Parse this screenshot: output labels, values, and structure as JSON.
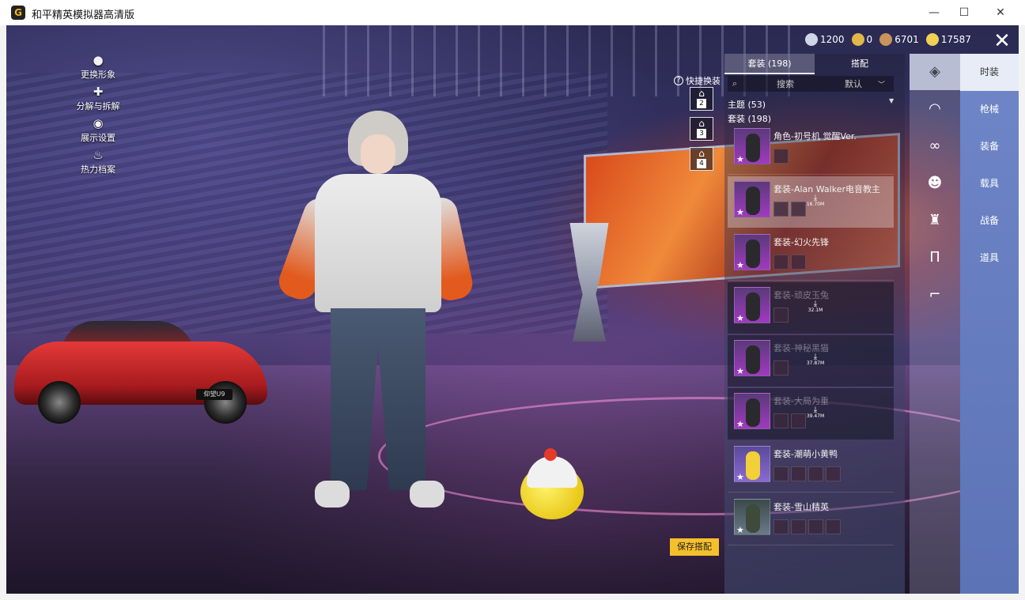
{
  "window": {
    "title": "和平精英模拟器高清版",
    "app_icon_glyph": "G",
    "min_glyph": "—",
    "max_glyph": "☐",
    "close_glyph": "✕"
  },
  "left_menu": [
    {
      "label": "更换形象",
      "icon": "person-icon",
      "glyph": "●"
    },
    {
      "label": "分解与拆解",
      "icon": "puzzle-icon",
      "glyph": "✚"
    },
    {
      "label": "展示设置",
      "icon": "eye-icon",
      "glyph": "◉"
    },
    {
      "label": "热力档案",
      "icon": "flame-icon",
      "glyph": "♨"
    }
  ],
  "currency": [
    {
      "value": "1200",
      "icon": "silver-coin-icon",
      "color": "#cfd6e6"
    },
    {
      "value": "0",
      "icon": "gold-badge-icon",
      "color": "#e0b84a"
    },
    {
      "value": "6701",
      "icon": "bronze-coin-icon",
      "color": "#c8945a"
    },
    {
      "value": "17587",
      "icon": "gold-coin-icon",
      "color": "#f2d056"
    }
  ],
  "close_glyph": "✕",
  "car_plate": "仰望U9",
  "quick_swap": {
    "label": "快捷换装",
    "help_glyph": "?",
    "slots": [
      "2",
      "3",
      "4"
    ],
    "slot_glyph": "⌂"
  },
  "save_button": "保存搭配",
  "panel": {
    "tabs": [
      {
        "label": "套装 (198)",
        "active": true
      },
      {
        "label": "搭配",
        "active": false
      }
    ],
    "search_glyph": "⌕",
    "search_placeholder": "搜索",
    "sort_label": "默认",
    "sort_caret": "﹀",
    "category_caret": "▼",
    "categories": [
      "主题 (53)",
      "套装 (198)"
    ],
    "items": [
      {
        "name": "角色-初号机 觉醒Ver.",
        "parts": 1,
        "download": "",
        "state": "plain"
      },
      {
        "name": "套装-Alan Walker电音教主",
        "parts": 2,
        "download": "16.70M",
        "state": "selected"
      },
      {
        "name": "套装-幻火先锋",
        "parts": 2,
        "download": "",
        "state": "plain"
      },
      {
        "name": "套装-顽皮玉兔",
        "parts": 1,
        "download": "32.1M",
        "state": "dim"
      },
      {
        "name": "套装-神秘黑猫",
        "parts": 1,
        "download": "37.87M",
        "state": "dim"
      },
      {
        "name": "套装-大局为重",
        "parts": 2,
        "download": "39.47M",
        "state": "dim"
      },
      {
        "name": "套装-潮萌小黄鸭",
        "parts": 4,
        "download": "",
        "state": "plain"
      },
      {
        "name": "套装-雪山精英",
        "parts": 4,
        "download": "",
        "state": "plain"
      }
    ],
    "star_glyph": "★",
    "download_glyph": "⤓"
  },
  "rail_icons": [
    {
      "icon": "outfit-icon",
      "glyph": "◈",
      "active": true
    },
    {
      "icon": "cap-icon",
      "glyph": "◠",
      "active": false
    },
    {
      "icon": "goggles-icon",
      "glyph": "∞",
      "active": false
    },
    {
      "icon": "mask-icon",
      "glyph": "☻",
      "active": false
    },
    {
      "icon": "jacket-icon",
      "glyph": "♜",
      "active": false
    },
    {
      "icon": "pants-icon",
      "glyph": "Π",
      "active": false
    },
    {
      "icon": "shoes-icon",
      "glyph": "⌐",
      "active": false
    }
  ],
  "categories_right": [
    {
      "label": "时装",
      "active": true
    },
    {
      "label": "枪械",
      "active": false
    },
    {
      "label": "装备",
      "active": false
    },
    {
      "label": "载具",
      "active": false
    },
    {
      "label": "战备",
      "active": false
    },
    {
      "label": "道具",
      "active": false
    }
  ]
}
